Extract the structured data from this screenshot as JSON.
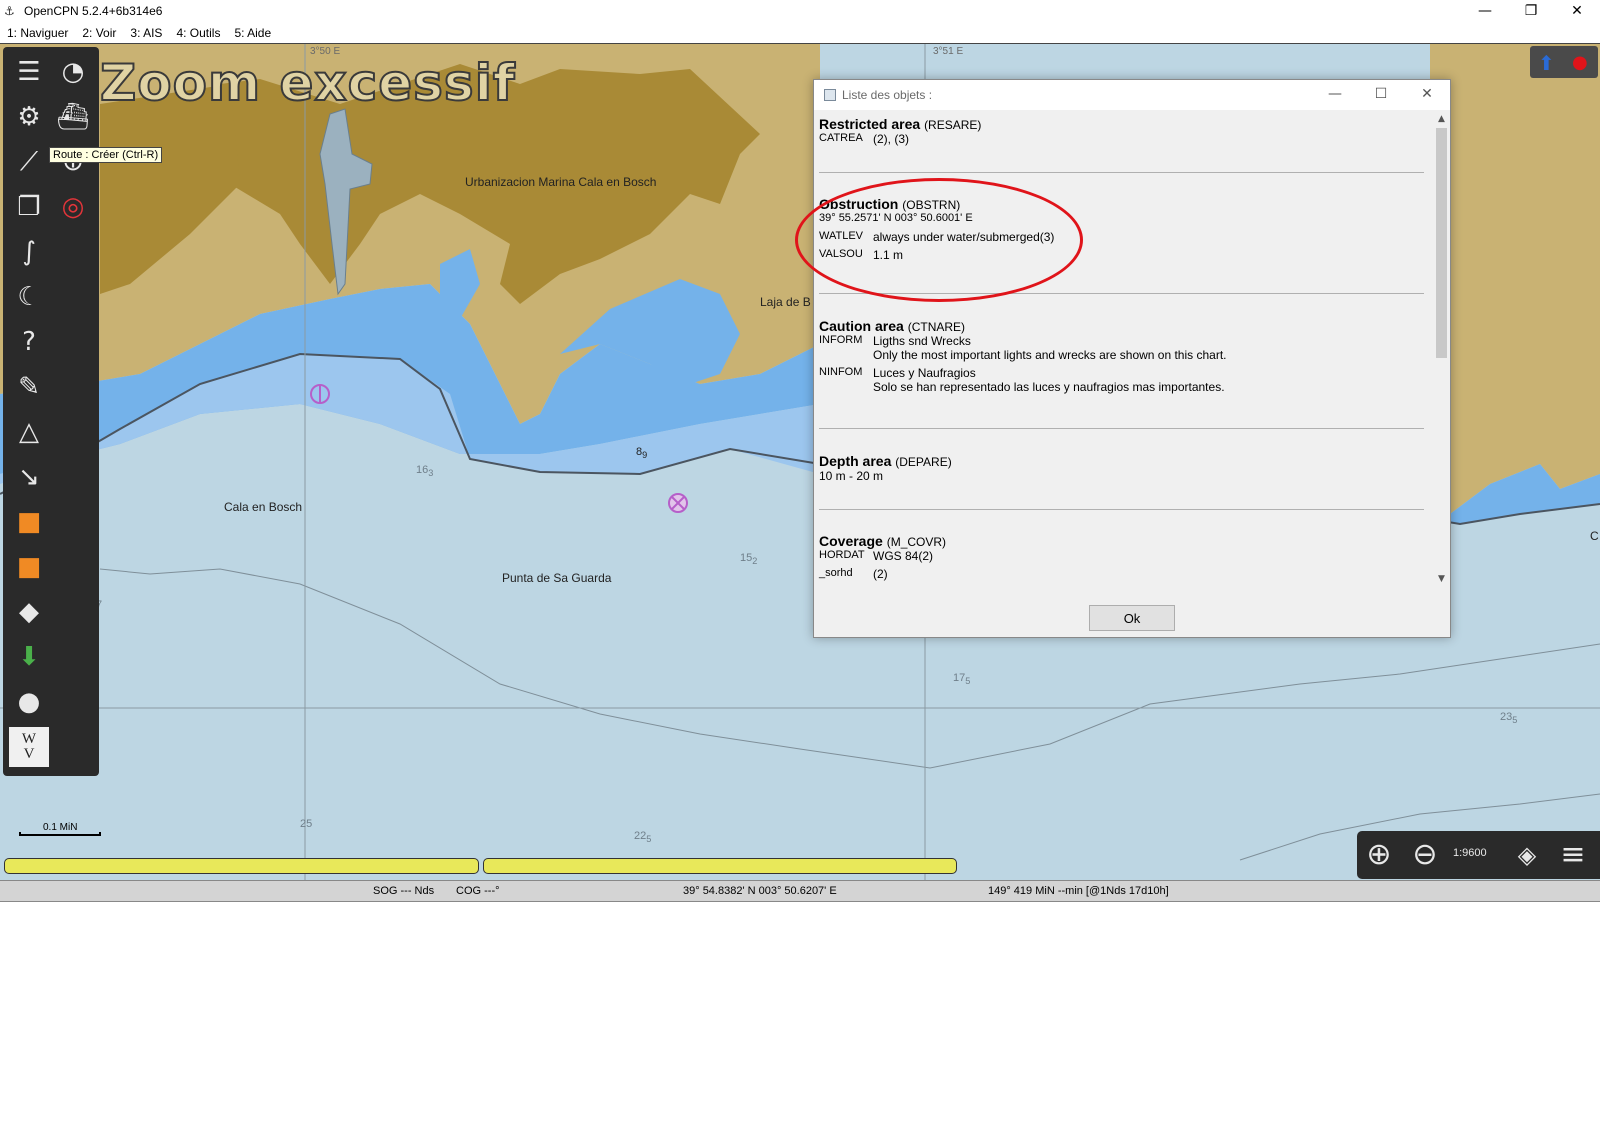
{
  "window": {
    "title": "OpenCPN 5.2.4+6b314e6",
    "app_icon": "compass-icon",
    "minimize": "—",
    "maximize": "❐",
    "close": "✕"
  },
  "menu": {
    "items": [
      "1: Naviguer",
      "2: Voir",
      "3: AIS",
      "4: Outils",
      "5: Aide"
    ]
  },
  "map": {
    "zoom_warning": "Zoom excessif",
    "lon_labels": [
      "3°50 E",
      "3°51 E"
    ],
    "place_labels": {
      "marina": "Urbanizacion Marina Cala en Bosch",
      "laja": "Laja de B",
      "cala": "Cala en Bosch",
      "punta": "Punta de Sa Guarda",
      "edge": "C"
    },
    "soundings": {
      "s1": "16",
      "s1sub": "3",
      "s2": "8",
      "s2sub": "9",
      "s3": "15",
      "s3sub": "2",
      "s4": "17",
      "s4sub": "5",
      "s5": "23",
      "s5sub": "5",
      "s6": "25",
      "s7": "22",
      "s7sub": "5",
      "s8": "7"
    },
    "colors": {
      "land": "#c9b273",
      "built_area": "#a98a36",
      "shallow": "#74b2ea",
      "medium": "#9cc6ee",
      "deep": "#bdd6e3"
    }
  },
  "toolbar": {
    "tooltip": "Route : Créer (Ctrl-R)",
    "watermark_top": "W",
    "watermark_bottom": "V"
  },
  "scale": {
    "label": "0.1 MiN",
    "ratio": "1:9600"
  },
  "status": {
    "sog": "SOG --- Nds",
    "cog": "COG ---°",
    "position": "39° 54.8382' N   003° 50.6207' E",
    "bearing": "149°  419 MiN --min [@1Nds 17d10h]"
  },
  "dialog": {
    "title": "Liste des objets :",
    "ok_label": "Ok",
    "objects": {
      "resare": {
        "name": "Restricted area",
        "code": "(RESARE)",
        "attrs": [
          {
            "k": "CATREA",
            "v": "(2), (3)"
          }
        ]
      },
      "obstrn": {
        "name": "Obstruction",
        "code": "(OBSTRN)",
        "position": "39° 55.2571' N 003° 50.6001' E",
        "attrs": [
          {
            "k": "WATLEV",
            "v": "always under water/submerged(3)"
          },
          {
            "k": "VALSOU",
            "v": "1.1 m"
          }
        ]
      },
      "ctnare": {
        "name": "Caution area",
        "code": "(CTNARE)",
        "inform_k": "INFORM",
        "inform_1": "Ligths snd Wrecks",
        "inform_2": "Only the most important lights and wrecks are shown on this chart.",
        "ninfom_k": "NINFOM",
        "ninfom_1": "Luces y Naufragios",
        "ninfom_2": "Solo se han representado las luces y naufragios mas importantes."
      },
      "depare": {
        "name": "Depth area",
        "code": "(DEPARE)",
        "line": "10 m - 20 m"
      },
      "m_covr": {
        "name": "Coverage",
        "code": "(M_COVR)",
        "attrs": [
          {
            "k": "HORDAT",
            "v": "WGS 84(2)"
          },
          {
            "k": "_sorhd",
            "v": "(2)"
          }
        ]
      }
    }
  }
}
